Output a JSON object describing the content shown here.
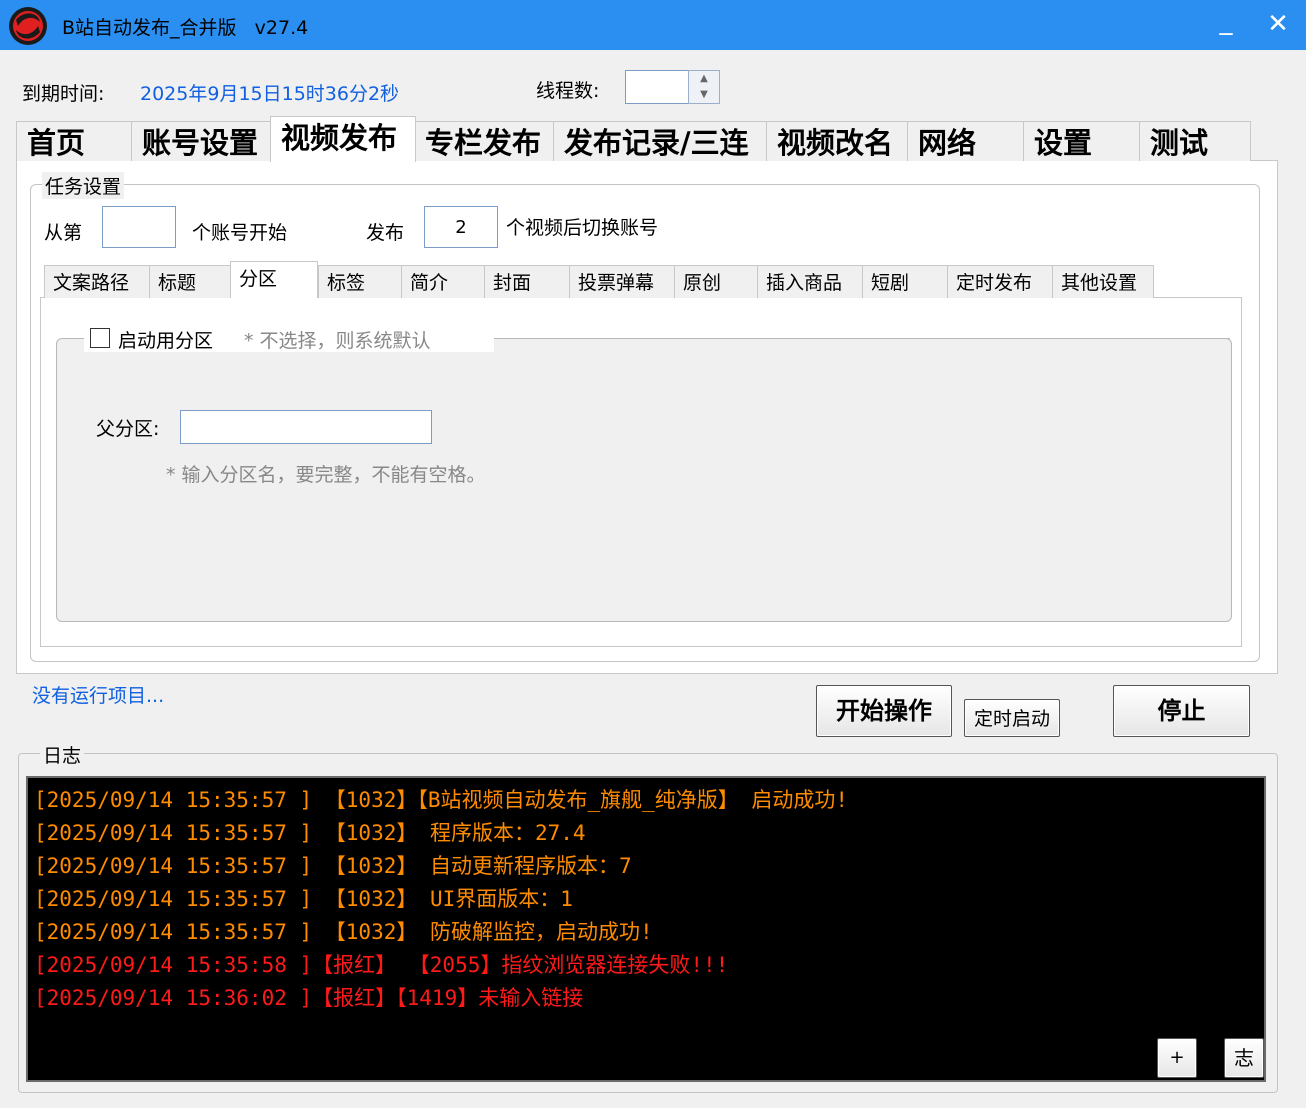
{
  "window": {
    "title": "B站自动发布_合并版",
    "version": "v27.4",
    "minimize_label": "_",
    "close_label": "✕",
    "title_bar_color": "#2a8ff0"
  },
  "header": {
    "expiry_label": "到期时间:",
    "expiry_value": "2025年9月15日15时36分2秒",
    "threads_label": "线程数:",
    "threads_value": ""
  },
  "main_tabs": [
    {
      "label": "首页"
    },
    {
      "label": "账号设置"
    },
    {
      "label": "视频发布",
      "active": true
    },
    {
      "label": "专栏发布"
    },
    {
      "label": "发布记录/三连"
    },
    {
      "label": "视频改名"
    },
    {
      "label": "网络"
    },
    {
      "label": "设置"
    },
    {
      "label": "测试"
    }
  ],
  "task_settings": {
    "group_title": "任务设置",
    "from_label": "从第",
    "from_value": "",
    "from_suffix": "个账号开始",
    "publish_label": "发布",
    "publish_value": "2",
    "publish_suffix": "个视频后切换账号"
  },
  "sub_tabs": [
    {
      "label": "文案路径"
    },
    {
      "label": "标题"
    },
    {
      "label": "分区",
      "active": true
    },
    {
      "label": "标签"
    },
    {
      "label": "简介"
    },
    {
      "label": "封面"
    },
    {
      "label": "投票弹幕"
    },
    {
      "label": "原创"
    },
    {
      "label": "插入商品"
    },
    {
      "label": "短剧"
    },
    {
      "label": "定时发布"
    },
    {
      "label": "其他设置"
    }
  ],
  "partition": {
    "enable_label": "启动用分区",
    "enable_checked": false,
    "enable_hint": "* 不选择，则系统默认",
    "parent_label": "父分区:",
    "parent_value": "",
    "parent_hint": "* 输入分区名，要完整，不能有空格。"
  },
  "status": {
    "text": "没有运行项目..."
  },
  "buttons": {
    "start": "开始操作",
    "scheduled": "定时启动",
    "stop": "停止"
  },
  "log": {
    "group_title": "日志",
    "lines": [
      {
        "text": "[2025/09/14 15:35:57 ] 【1032】【B站视频自动发布_旗舰_纯净版】 启动成功!",
        "color": "#ff8c00"
      },
      {
        "text": "[2025/09/14 15:35:57 ] 【1032】 程序版本：27.4",
        "color": "#ff8c00"
      },
      {
        "text": "[2025/09/14 15:35:57 ] 【1032】 自动更新程序版本：7",
        "color": "#ff8c00"
      },
      {
        "text": "[2025/09/14 15:35:57 ] 【1032】 UI界面版本：1",
        "color": "#ff8c00"
      },
      {
        "text": "[2025/09/14 15:35:57 ] 【1032】 防破解监控，启动成功!",
        "color": "#ff8c00"
      },
      {
        "text": "[2025/09/14 15:35:58 ]【报红】 【2055】指纹浏览器连接失败!!!",
        "color": "#ff1a1a"
      },
      {
        "text": "[2025/09/14 15:36:02 ]【报红】【1419】未输入链接",
        "color": "#ff1a1a"
      }
    ],
    "plus_label": "+",
    "log_button_label": "志"
  }
}
